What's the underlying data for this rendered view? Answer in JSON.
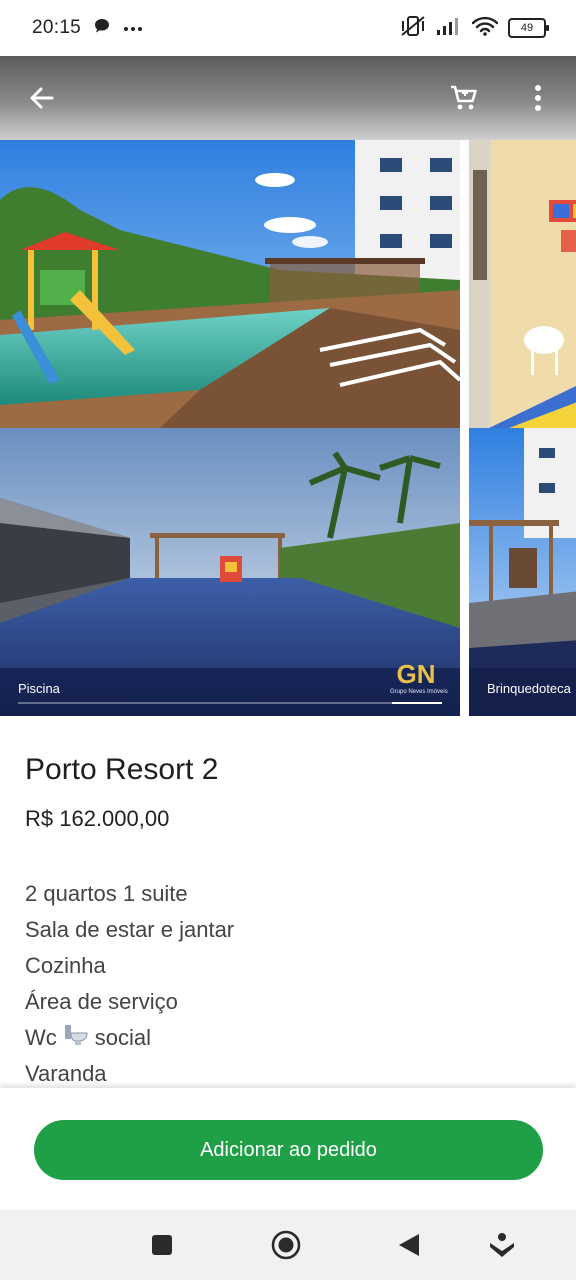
{
  "status_bar": {
    "time": "20:15",
    "battery": "49",
    "icons": [
      "chat-bubble-icon",
      "more-dots-icon",
      "vibrate-off-icon",
      "signal-icon",
      "wifi-icon",
      "battery-icon"
    ]
  },
  "app_bar": {
    "back_icon": "arrow-left-icon",
    "cart_icon": "cart-icon",
    "menu_icon": "more-vert-icon"
  },
  "gallery": {
    "photos": [
      {
        "caption": "Piscina"
      },
      {
        "caption": "Brinquedoteca"
      }
    ],
    "logo_text": "GN",
    "logo_subtext": "Grupo Neves Imóveis"
  },
  "product": {
    "title": "Porto Resort 2",
    "price": "R$ 162.000,00",
    "description": [
      "2 quartos 1 suite",
      "Sala de estar e jantar",
      "Cozinha",
      "Área de serviço",
      "Wc",
      "social",
      "Varanda"
    ]
  },
  "actions": {
    "add_label": "Adicionar ao pedido",
    "accent_color": "#1fa047"
  },
  "nav_bar": {
    "icons": [
      "recents-square-icon",
      "home-circle-icon",
      "back-triangle-icon",
      "assistant-icon"
    ]
  }
}
